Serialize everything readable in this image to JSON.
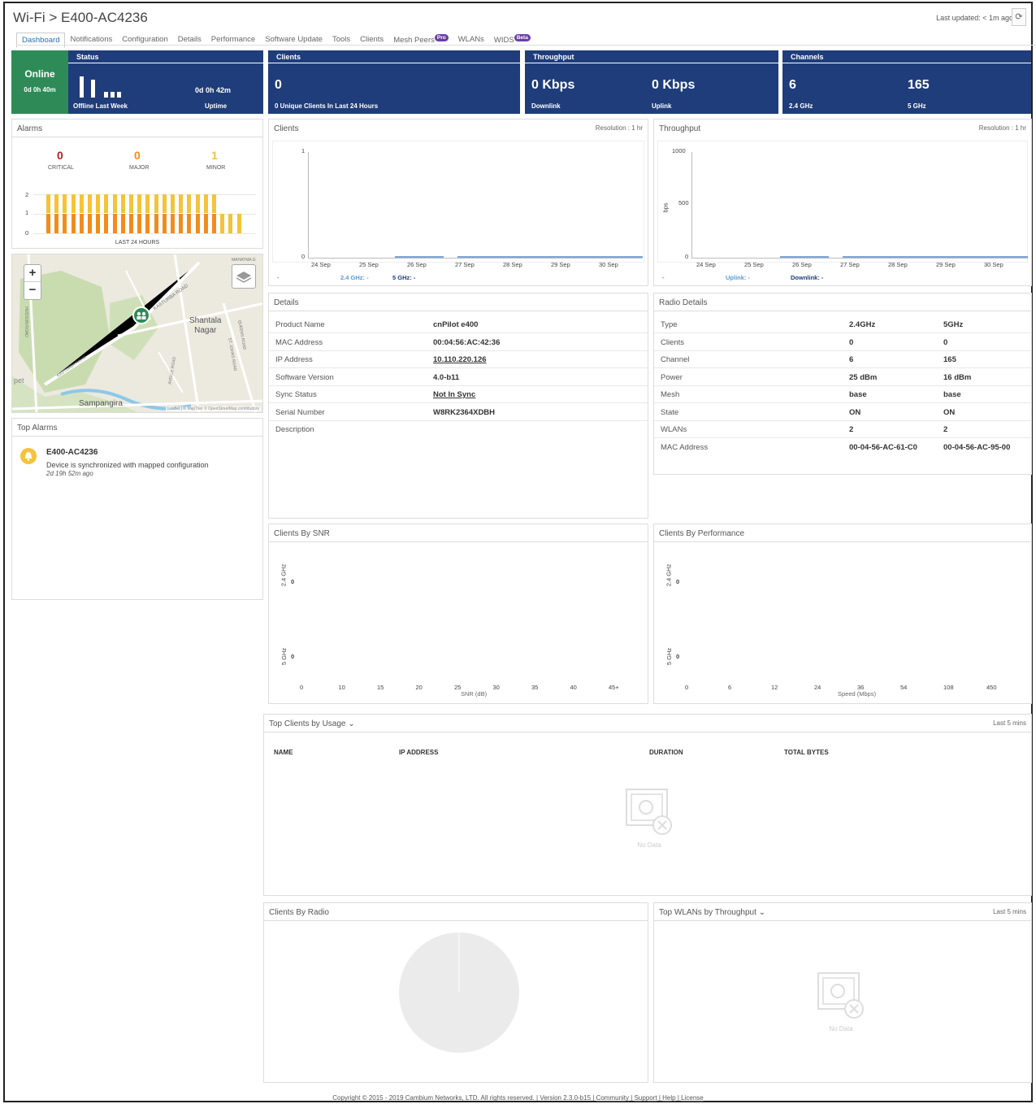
{
  "header": {
    "title": "Wi-Fi > E400-AC4236",
    "last_updated": "Last updated: < 1m ago",
    "refresh": "⟳"
  },
  "tabs": [
    {
      "label": "Dashboard"
    },
    {
      "label": "Notifications"
    },
    {
      "label": "Configuration"
    },
    {
      "label": "Details"
    },
    {
      "label": "Performance"
    },
    {
      "label": "Software Update"
    },
    {
      "label": "Tools"
    },
    {
      "label": "Clients"
    },
    {
      "label": "Mesh Peers",
      "badge": "Pro"
    },
    {
      "label": "WLANs"
    },
    {
      "label": "WIDS",
      "badge": "Beta"
    }
  ],
  "status": {
    "state": "Online",
    "online_time": "0d 0h 40m",
    "header": "Status",
    "offline_label": "Offline Last Week",
    "uptime_value": "0d 0h 42m",
    "uptime_label": "Uptime"
  },
  "clients_kpi": {
    "header": "Clients",
    "value": "0",
    "label": "0 Unique Clients In Last 24 Hours"
  },
  "throughput_kpi": {
    "header": "Throughput",
    "down_value": "0 Kbps",
    "down_label": "Downlink",
    "up_value": "0 Kbps",
    "up_label": "Uplink"
  },
  "channels_kpi": {
    "header": "Channels",
    "ch24": "6",
    "ch24_label": "2.4 GHz",
    "ch5": "165",
    "ch5_label": "5 GHz"
  },
  "alarms": {
    "title": "Alarms",
    "critical": "0",
    "critical_label": "CRITICAL",
    "major": "0",
    "major_label": "MAJOR",
    "minor": "1",
    "minor_label": "MINOR",
    "y_ticks": [
      "2",
      "1",
      "0"
    ],
    "footer": "LAST 24 HOURS",
    "counts": [
      2,
      2,
      2,
      2,
      2,
      2,
      2,
      2,
      2,
      2,
      2,
      2,
      2,
      2,
      2,
      2,
      2,
      2,
      2,
      2,
      2,
      1,
      1,
      1
    ]
  },
  "map": {
    "labels": [
      "Shantala\nNagar",
      "KASTURBA ROAD",
      "Sampangira",
      "pet",
      "MAHATMA G",
      "KASTURBA ROAD",
      "AVELLE ROAD",
      "ST. JOHNS ROAD",
      "QUEENS ROAD",
      "HUDSON ROAD"
    ],
    "attribution": "Leaflet | © MapTiler © OpenStreetMap contributors",
    "zoom_in": "+",
    "zoom_out": "−"
  },
  "top_alarms": {
    "title": "Top Alarms",
    "device": "E400-AC4236",
    "message": "Device is synchronized with mapped configuration",
    "time": "2d 19h 52m ago"
  },
  "clients_chart": {
    "title": "Clients",
    "resolution": "Resolution : 1 hr",
    "y_ticks": [
      "1",
      "0"
    ],
    "x_ticks": [
      "24 Sep",
      "25 Sep",
      "26 Sep",
      "27 Sep",
      "28 Sep",
      "29 Sep",
      "30 Sep"
    ],
    "legend_dash": "-",
    "legend_24": "2.4 GHz: -",
    "legend_5": "5 GHz: -"
  },
  "throughput_chart": {
    "title": "Throughput",
    "resolution": "Resolution : 1 hr",
    "y_ticks": [
      "1000",
      "500",
      "0"
    ],
    "ylabel": "bps",
    "x_ticks": [
      "24 Sep",
      "25 Sep",
      "26 Sep",
      "27 Sep",
      "28 Sep",
      "29 Sep",
      "30 Sep"
    ],
    "legend_dash": "-",
    "legend_up": "Uplink: -",
    "legend_down": "Downlink: -"
  },
  "details": {
    "title": "Details",
    "rows": [
      {
        "k": "Product Name",
        "v": "cnPilot e400"
      },
      {
        "k": "MAC Address",
        "v": "00:04:56:AC:42:36"
      },
      {
        "k": "IP Address",
        "v": "10.110.220.126"
      },
      {
        "k": "Software Version",
        "v": "4.0-b11"
      },
      {
        "k": "Sync Status",
        "v": "Not In Sync"
      },
      {
        "k": "Serial Number",
        "v": "W8RK2364XDBH"
      },
      {
        "k": "Description",
        "v": ""
      }
    ]
  },
  "radio": {
    "title": "Radio Details",
    "rows": [
      {
        "k": "Type",
        "a": "2.4GHz",
        "b": "5GHz"
      },
      {
        "k": "Clients",
        "a": "0",
        "b": "0"
      },
      {
        "k": "Channel",
        "a": "6",
        "b": "165"
      },
      {
        "k": "Power",
        "a": "25 dBm",
        "b": "16 dBm"
      },
      {
        "k": "Mesh",
        "a": "base",
        "b": "base"
      },
      {
        "k": "State",
        "a": "ON",
        "b": "ON"
      },
      {
        "k": "WLANs",
        "a": "2",
        "b": "2"
      },
      {
        "k": "MAC Address",
        "a": "00-04-56-AC-61-C0",
        "b": "00-04-56-AC-95-00"
      }
    ]
  },
  "snr": {
    "title": "Clients By SNR",
    "y24": "2.4 GHz",
    "y5": "5 GHz",
    "v24": "0",
    "v5": "0",
    "x_ticks": [
      "0",
      "10",
      "15",
      "20",
      "25",
      "30",
      "35",
      "40",
      "45+"
    ],
    "xlabel": "SNR (dB)"
  },
  "perf": {
    "title": "Clients By Performance",
    "y24": "2.4 GHz",
    "y5": "5 GHz",
    "v24": "0",
    "v5": "0",
    "x_ticks": [
      "0",
      "6",
      "12",
      "24",
      "36",
      "54",
      "108",
      "450"
    ],
    "xlabel": "Speed (Mbps)"
  },
  "top_clients": {
    "title": "Top Clients by Usage ⌄",
    "range": "Last 5 mins",
    "cols": [
      "NAME",
      "IP ADDRESS",
      "DURATION",
      "TOTAL BYTES"
    ],
    "nodata": "No Data"
  },
  "clients_radio": {
    "title": "Clients By Radio"
  },
  "top_wlans": {
    "title": "Top WLANs by Throughput ⌄",
    "range": "Last 5 mins",
    "nodata": "No Data"
  },
  "footer": {
    "copyright": "Copyright © 2015 - 2019 Cambium Networks, LTD. All rights reserved.",
    "version": "Version 2.3.0-b15",
    "community": "Community",
    "support": "Support",
    "help": "Help",
    "license": "License",
    "sep": "|"
  },
  "colors": {
    "kpi": "#1f3d7a",
    "online": "#2e8b57",
    "alarm_orange": "#f28c1c",
    "alarm_yellow": "#f5c23a",
    "critical": "#b22222"
  }
}
